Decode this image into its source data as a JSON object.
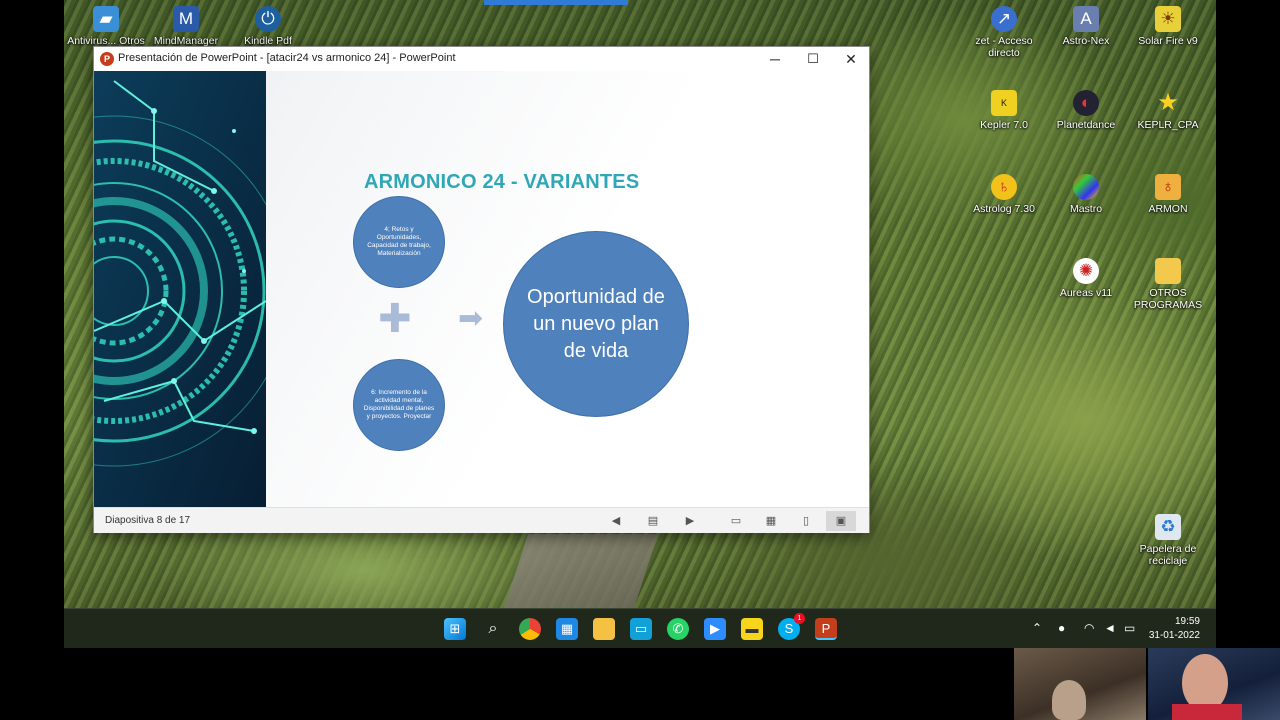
{
  "window": {
    "title": "Presentación de PowerPoint - [atacir24 vs armonico 24] - PowerPoint",
    "minimize": "─",
    "maximize": "☐",
    "close": "✕"
  },
  "slide": {
    "title": "ARMONICO 24 - VARIANTES",
    "circle_top": "4; Retos y Oportunidades, Capacidad de trabajo, Materialización",
    "circle_bottom": "6: Incremento de la actividad mental, Disponibilidad de planes y proyectos. Proyectar",
    "circle_main": "Oportunidad de un nuevo plan de vida",
    "plus_symbol": "✚",
    "arrow_symbol": "➡"
  },
  "statusbar": {
    "slide_counter": "Diapositiva 8 de 17",
    "prev_icon": "◀",
    "menu_icon": "▤",
    "next_icon": "▶",
    "normal_view_icon": "▭",
    "sorter_view_icon": "▦",
    "reading_view_icon": "▯",
    "slideshow_icon": "▣"
  },
  "desktop": {
    "top_left_icons": [
      "Antivirus... Otros",
      "MindManager",
      "Kindle Pdf"
    ],
    "right_icons": [
      {
        "label": "zet - Acceso directo",
        "icon": "zet-icon"
      },
      {
        "label": "Astro-Nex",
        "icon": "astro-nex-icon"
      },
      {
        "label": "Solar Fire v9",
        "icon": "solar-fire-icon"
      },
      {
        "label": "Kepler 7.0",
        "icon": "kepler-icon"
      },
      {
        "label": "Planetdance",
        "icon": "planetdance-icon"
      },
      {
        "label": "KEPLR_CPA",
        "icon": "star-icon"
      },
      {
        "label": "Astrolog 7.30",
        "icon": "astrolog-icon"
      },
      {
        "label": "Mastro",
        "icon": "mastro-icon"
      },
      {
        "label": "ARMON",
        "icon": "armon-icon"
      },
      {
        "label": "Aureas v11",
        "icon": "aureas-icon"
      },
      {
        "label": "OTROS PROGRAMAS",
        "icon": "folder-icon"
      },
      {
        "label": "Papelera de reciclaje",
        "icon": "recycle-bin-icon"
      }
    ]
  },
  "taskbar": {
    "time": "19:59",
    "date": "31-01-2022",
    "skype_badge": "1"
  },
  "colors": {
    "slide_title": "#2fa7b6",
    "circle_fill": "#4f81bd",
    "taskbar": "#20281c",
    "ppt_red": "#c43e1c"
  }
}
